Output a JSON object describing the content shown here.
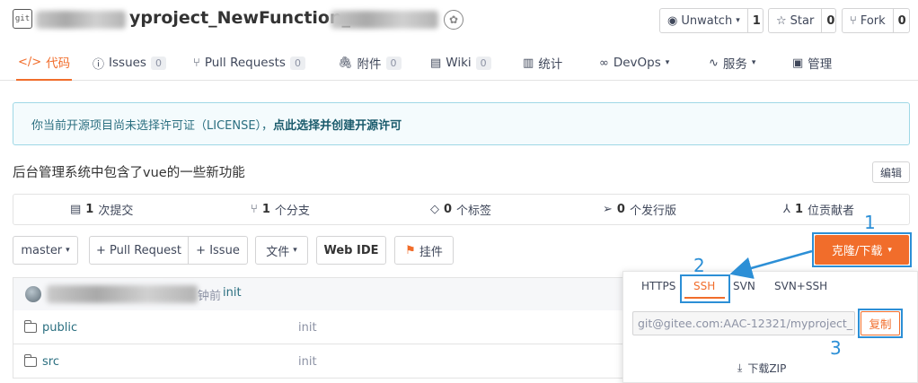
{
  "header": {
    "repo_title": "yproject_NewFunction_",
    "repo_icon_text": "git",
    "watch": {
      "label": "Unwatch",
      "count": "1"
    },
    "star": {
      "label": "Star",
      "count": "0"
    },
    "fork": {
      "label": "Fork",
      "count": "0"
    }
  },
  "tabs": [
    {
      "label": "代码"
    },
    {
      "label": "Issues",
      "badge": "0"
    },
    {
      "label": "Pull Requests",
      "badge": "0"
    },
    {
      "label": "附件",
      "badge": "0"
    },
    {
      "label": "Wiki",
      "badge": "0"
    },
    {
      "label": "统计"
    },
    {
      "label": "DevOps"
    },
    {
      "label": "服务"
    },
    {
      "label": "管理"
    }
  ],
  "notice": {
    "text": "你当前开源项目尚未选择许可证（LICENSE），",
    "link": "点此选择并创建开源许可"
  },
  "description": "后台管理系统中包含了vue的一些新功能",
  "edit_label": "编辑",
  "stats": [
    {
      "count": "1",
      "label": "次提交"
    },
    {
      "count": "1",
      "label": "个分支"
    },
    {
      "count": "0",
      "label": "个标签"
    },
    {
      "count": "0",
      "label": "个发行版"
    },
    {
      "count": "1",
      "label": "位贡献者"
    }
  ],
  "toolbar": {
    "branch": "master",
    "pull_request": "+ Pull Request",
    "issue": "+ Issue",
    "file": "文件",
    "web_ide": "Web IDE",
    "widget": "挂件",
    "clone": "克隆/下载"
  },
  "commit": {
    "time_suffix": "钟前",
    "message": "init"
  },
  "files": [
    {
      "name": "public",
      "message": "init"
    },
    {
      "name": "src",
      "message": "init"
    }
  ],
  "clone_panel": {
    "protocols": [
      "HTTPS",
      "SSH",
      "SVN",
      "SVN+SSH"
    ],
    "selected_protocol": "SSH",
    "url": "git@gitee.com:AAC-12321/myproject_",
    "copy_label": "复制",
    "download_zip": "下载ZIP"
  },
  "annotations": [
    "1",
    "2",
    "3"
  ],
  "colors": {
    "accent": "#f16d2b",
    "annotation": "#2c8fd6",
    "link": "#2b6f80"
  }
}
